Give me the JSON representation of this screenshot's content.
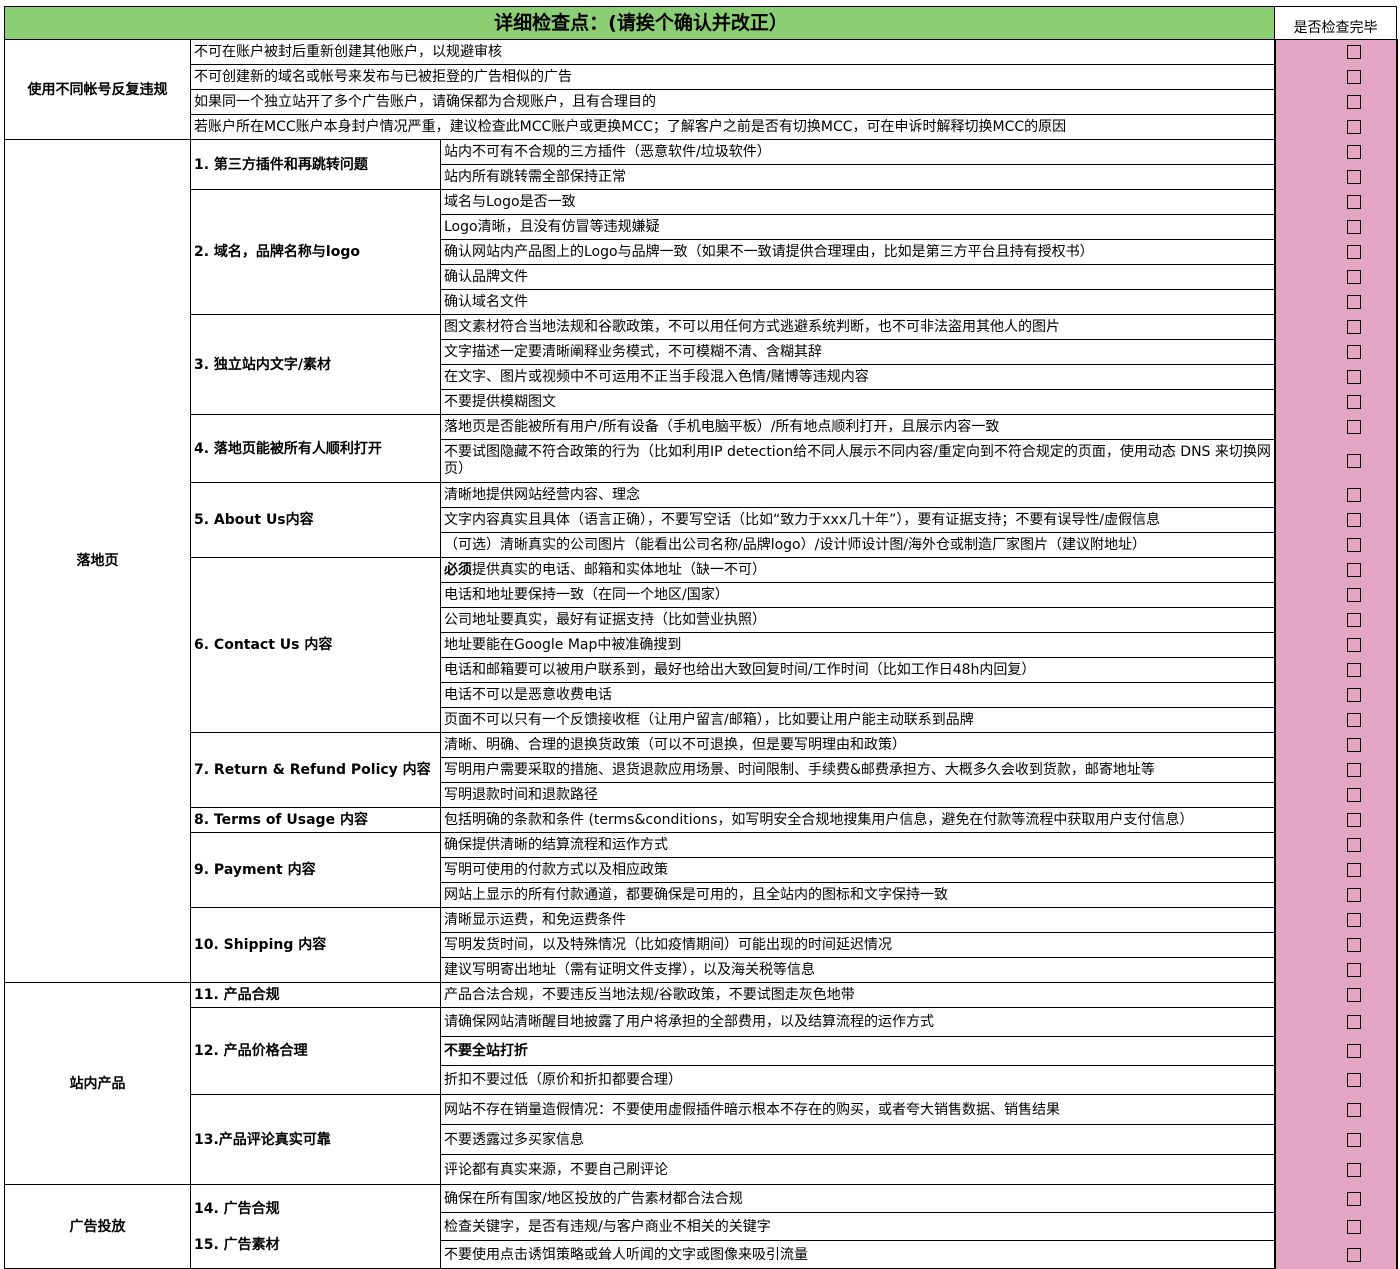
{
  "top_strip": "",
  "header": {
    "title": "详细检查点：(请挨个确认并改正）",
    "check_header": "是否检查完毕"
  },
  "groups": [
    {
      "category": "使用不同帐号反复违规",
      "subs": [
        {
          "label": "",
          "items": [
            {
              "text": "不可在账户被封后重新创建其他账户，以规避审核"
            },
            {
              "text": "不可创建新的域名或帐号来发布与已被拒登的广告相似的广告"
            },
            {
              "text": "如果同一个独立站开了多个广告账户，请确保都为合规账户，且有合理目的"
            },
            {
              "text": "若账户所在MCC账户本身封户情况严重，建议检查此MCC账户或更换MCC；了解客户之前是否有切换MCC，可在申诉时解释切换MCC的原因"
            }
          ]
        }
      ]
    },
    {
      "category": "落地页",
      "subs": [
        {
          "label": "1. 第三方插件和再跳转问题",
          "items": [
            {
              "text": "站内不可有不合规的三方插件（恶意软件/垃圾软件）"
            },
            {
              "text": "站内所有跳转需全部保持正常"
            }
          ]
        },
        {
          "label": "2. 域名，品牌名称与logo",
          "items": [
            {
              "text": "域名与Logo是否一致"
            },
            {
              "text": "Logo清晰，且没有仿冒等违规嫌疑"
            },
            {
              "text": "确认网站内产品图上的Logo与品牌一致（如果不一致请提供合理理由，比如是第三方平台且持有授权书）"
            },
            {
              "text": "确认品牌文件"
            },
            {
              "text": "确认域名文件"
            }
          ]
        },
        {
          "label": "3. 独立站内文字/素材",
          "items": [
            {
              "text": "图文素材符合当地法规和谷歌政策，不可以用任何方式逃避系统判断，也不可非法盗用其他人的图片"
            },
            {
              "text": "文字描述一定要清晰阐释业务模式，不可模糊不清、含糊其辞"
            },
            {
              "text": "在文字、图片或视频中不可运用不正当手段混入色情/赌博等违规内容"
            },
            {
              "text": "不要提供模糊图文"
            }
          ]
        },
        {
          "label": "4. 落地页能被所有人顺利打开",
          "items": [
            {
              "text": "落地页是否能被所有用户/所有设备（手机电脑平板）/所有地点顺利打开，且展示内容一致"
            },
            {
              "text": "不要试图隐藏不符合政策的行为（比如利用IP detection给不同人展示不同内容/重定向到不符合规定的页面，使用动态 DNS 来切换网页）",
              "wrap": true
            }
          ]
        },
        {
          "label": "5. About Us内容",
          "items": [
            {
              "text": "清晰地提供网站经营内容、理念"
            },
            {
              "text": "文字内容真实且具体（语言正确），不要写空话（比如“致力于xxx几十年”），要有证据支持；不要有误导性/虚假信息"
            },
            {
              "text": "（可选）清晰真实的公司图片（能看出公司名称/品牌logo）/设计师设计图/海外仓或制造厂家图片（建议附地址）"
            }
          ]
        },
        {
          "label": "6. Contact Us 内容",
          "items": [
            {
              "bold": "必须",
              "text": "提供真实的电话、邮箱和实体地址（缺一不可）"
            },
            {
              "text": "电话和地址要保持一致（在同一个地区/国家）"
            },
            {
              "text": "公司地址要真实，最好有证据支持（比如营业执照）"
            },
            {
              "text": "地址要能在Google Map中被准确搜到"
            },
            {
              "text": "电话和邮箱要可以被用户联系到，最好也给出大致回复时间/工作时间（比如工作日48h内回复）"
            },
            {
              "text": "电话不可以是恶意收费电话"
            },
            {
              "text": "页面不可以只有一个反馈接收框（让用户留言/邮箱），比如要让用户能主动联系到品牌"
            }
          ]
        },
        {
          "label": "7. Return & Refund Policy 内容",
          "items": [
            {
              "text": "清晰、明确、合理的退换货政策（可以不可退换，但是要写明理由和政策）"
            },
            {
              "text": "写明用户需要采取的措施、退货退款应用场景、时间限制、手续费&邮费承担方、大概多久会收到货款，邮寄地址等"
            },
            {
              "text": "写明退款时间和退款路径"
            }
          ]
        },
        {
          "label": "8. Terms of Usage 内容",
          "items": [
            {
              "text": "包括明确的条款和条件 (terms&conditions，如写明安全合规地搜集用户信息，避免在付款等流程中获取用户支付信息）"
            }
          ]
        },
        {
          "label": "9. Payment 内容",
          "items": [
            {
              "text": "确保提供清晰的结算流程和运作方式"
            },
            {
              "text": "写明可使用的付款方式以及相应政策"
            },
            {
              "text": "网站上显示的所有付款通道，都要确保是可用的，且全站内的图标和文字保持一致"
            }
          ]
        },
        {
          "label": "10. Shipping 内容",
          "items": [
            {
              "text": "清晰显示运费，和免运费条件"
            },
            {
              "text": "写明发货时间，以及特殊情况（比如疫情期间）可能出现的时间延迟情况"
            },
            {
              "text": "建议写明寄出地址（需有证明文件支撑），以及海关税等信息"
            }
          ]
        }
      ]
    },
    {
      "category": "站内产品",
      "subs": [
        {
          "label": "11. 产品合规",
          "items": [
            {
              "text": "产品合法合规，不要违反当地法规/谷歌政策，不要试图走灰色地带"
            }
          ]
        },
        {
          "label": "12. 产品价格合理",
          "items": [
            {
              "text": "请确保网站清晰醒目地披露了用户将承担的全部费用，以及结算流程的运作方式"
            },
            {
              "bold": "不要全站打折",
              "text": ""
            },
            {
              "text": "折扣不要过低（原价和折扣都要合理）"
            }
          ]
        },
        {
          "label": "13.产品评论真实可靠",
          "items": [
            {
              "text": "网站不存在销量造假情况：不要使用虚假插件暗示根本不存在的购买，或者夸大销售数据、销售结果"
            },
            {
              "text": "不要透露过多买家信息"
            },
            {
              "text": "评论都有真实来源，不要自己刷评论"
            }
          ]
        }
      ]
    },
    {
      "category": "广告投放",
      "subs": [
        {
          "label": "14. 广告合规",
          "label2": "15. 广告素材",
          "items": [
            {
              "text": "确保在所有国家/地区投放的广告素材都合法合规"
            },
            {
              "text": "检查关键字，是否有违规/与客户商业不相关的关键字"
            },
            {
              "text": "不要使用点击诱饵策略或耸人听闻的文字或图像来吸引流量"
            }
          ]
        }
      ]
    }
  ]
}
